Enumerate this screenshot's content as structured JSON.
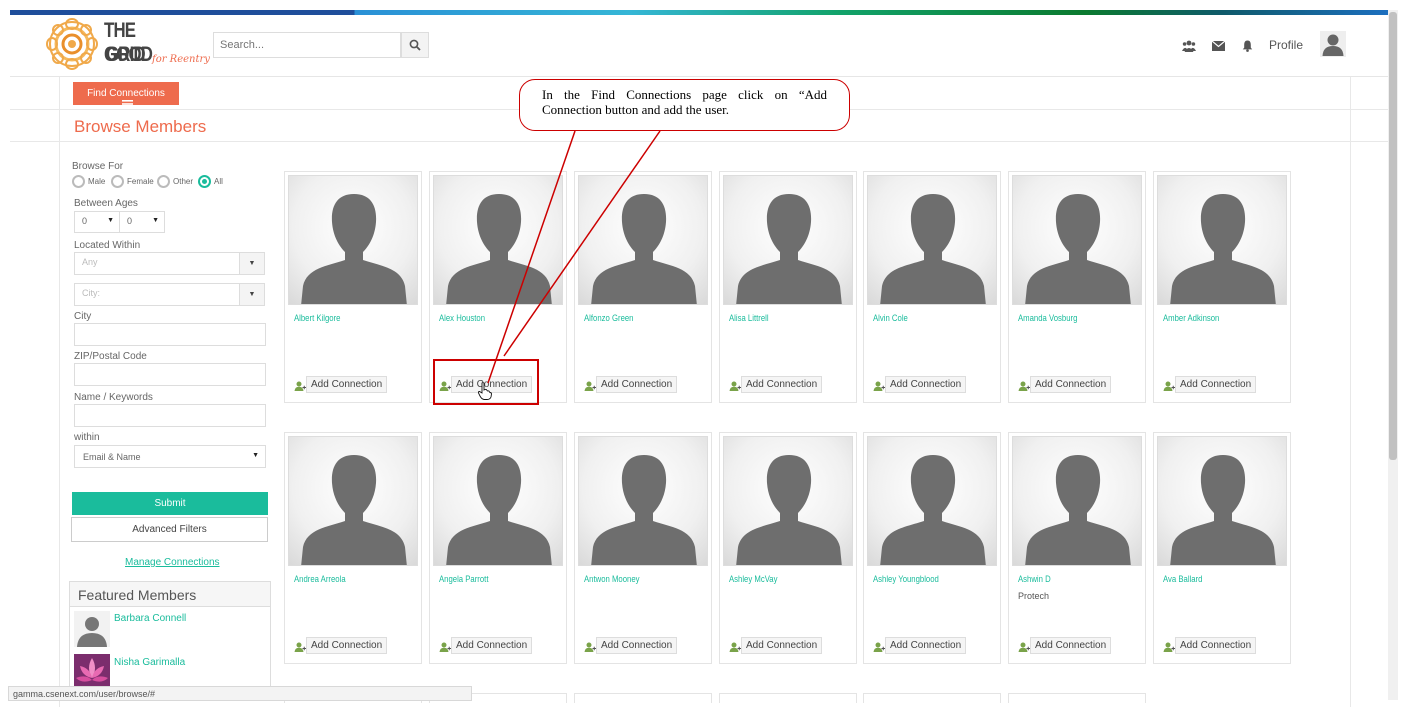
{
  "header": {
    "logo": {
      "line1": "THE GOOD",
      "line2": "GRID",
      "tagline": "for Reentry"
    },
    "search_placeholder": "Search...",
    "icons": [
      "users-icon",
      "mail-icon",
      "bell-icon"
    ],
    "profile_label": "Profile"
  },
  "toolbar": {
    "find_connections_label": "Find Connections",
    "page_title": "Browse Members"
  },
  "callout": {
    "text": "In the Find Connections page click on “Add Connection   button and add the user."
  },
  "filters": {
    "browse_for_label": "Browse For",
    "gender_options": [
      "Male",
      "Female",
      "Other",
      "All"
    ],
    "gender_selected": "All",
    "between_ages_label": "Between Ages",
    "age_from": "0",
    "age_to": "0",
    "located_within_label": "Located Within",
    "located_within_value": "Any",
    "city_select_placeholder": "City:",
    "city_label": "City",
    "zip_label": "ZIP/Postal Code",
    "keywords_label": "Name / Keywords",
    "within_label": "within",
    "within_value": "Email & Name",
    "submit_label": "Submit",
    "advanced_label": "Advanced Filters",
    "manage_label": "Manage Connections"
  },
  "featured": {
    "title": "Featured Members",
    "members": [
      {
        "name": "Barbara Connell"
      },
      {
        "name": "Nisha Garimalla"
      }
    ]
  },
  "members_row1": [
    {
      "name": "Albert Kilgore",
      "sub": "",
      "action": "Add Connection"
    },
    {
      "name": "Alex Houston",
      "sub": "",
      "action": "Add Connection"
    },
    {
      "name": "Alfonzo Green",
      "sub": "",
      "action": "Add Connection"
    },
    {
      "name": "Alisa Littrell",
      "sub": "",
      "action": "Add Connection"
    },
    {
      "name": "Alvin Cole",
      "sub": "",
      "action": "Add Connection"
    },
    {
      "name": "Amanda Vosburg",
      "sub": "",
      "action": "Add Connection"
    },
    {
      "name": "Amber Adkinson",
      "sub": "",
      "action": "Add Connection"
    }
  ],
  "members_row2": [
    {
      "name": "Andrea Arreola",
      "sub": "",
      "action": "Add Connection"
    },
    {
      "name": "Angela Parrott",
      "sub": "",
      "action": "Add Connection"
    },
    {
      "name": "Antwon Mooney",
      "sub": "",
      "action": "Add Connection"
    },
    {
      "name": "Ashley McVay",
      "sub": "",
      "action": "Add Connection"
    },
    {
      "name": "Ashley Youngblood",
      "sub": "",
      "action": "Add Connection"
    },
    {
      "name": "Ashwin D",
      "sub": "Protech",
      "action": "Add Connection"
    },
    {
      "name": "Ava Ballard",
      "sub": "",
      "action": "Add Connection"
    }
  ],
  "status_bar": {
    "url": "gamma.csenext.com/user/browse/#"
  },
  "colors": {
    "accent": "#1abc9c",
    "orange": "#ee6b4d",
    "annotation": "#cc0000"
  }
}
